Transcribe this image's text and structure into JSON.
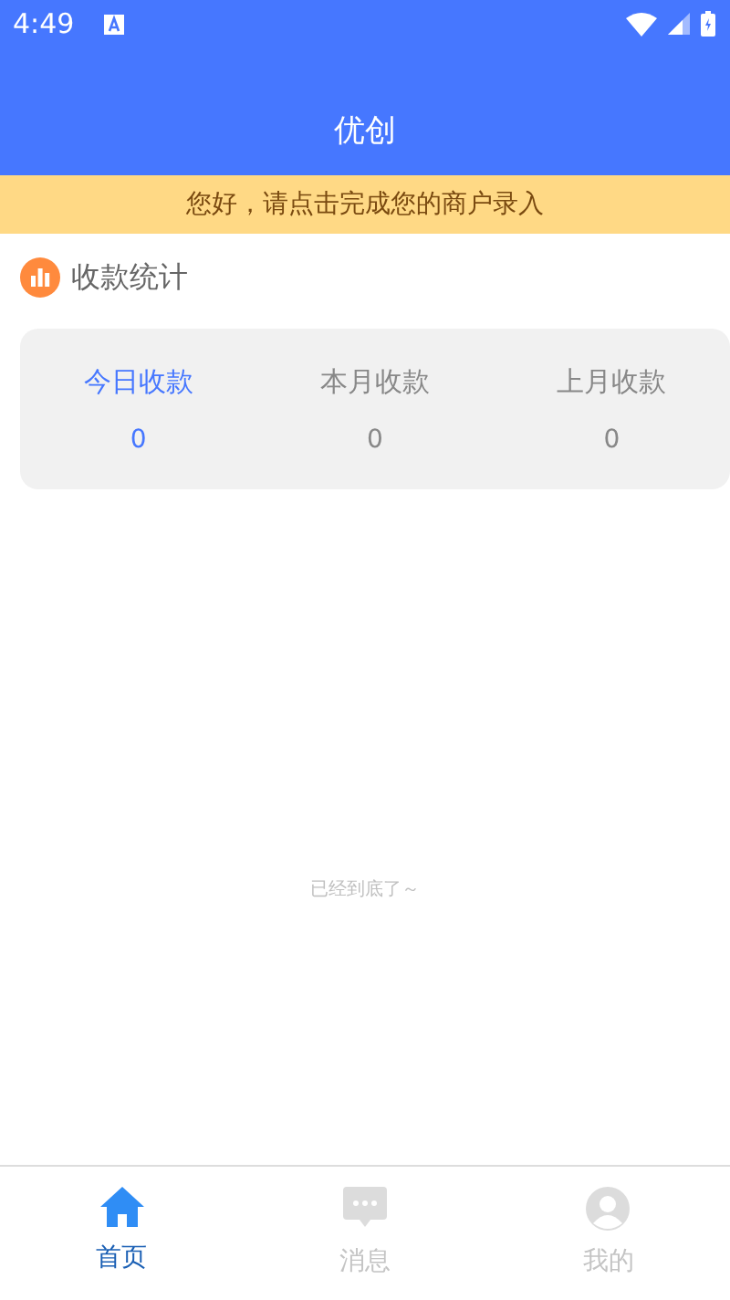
{
  "status_bar": {
    "time": "4:49"
  },
  "header": {
    "title": "优创"
  },
  "notice": {
    "text": "您好，请点击完成您的商户录入"
  },
  "section": {
    "title": "收款统计"
  },
  "stats": [
    {
      "label": "今日收款",
      "value": "0",
      "selected": true
    },
    {
      "label": "本月收款",
      "value": "0",
      "selected": false
    },
    {
      "label": "上月收款",
      "value": "0",
      "selected": false
    }
  ],
  "end_text": "已经到底了～",
  "tab_bar": [
    {
      "label": "首页",
      "kind": "home",
      "selected": true
    },
    {
      "label": "消息",
      "kind": "message",
      "selected": false
    },
    {
      "label": "我的",
      "kind": "profile",
      "selected": false
    }
  ]
}
